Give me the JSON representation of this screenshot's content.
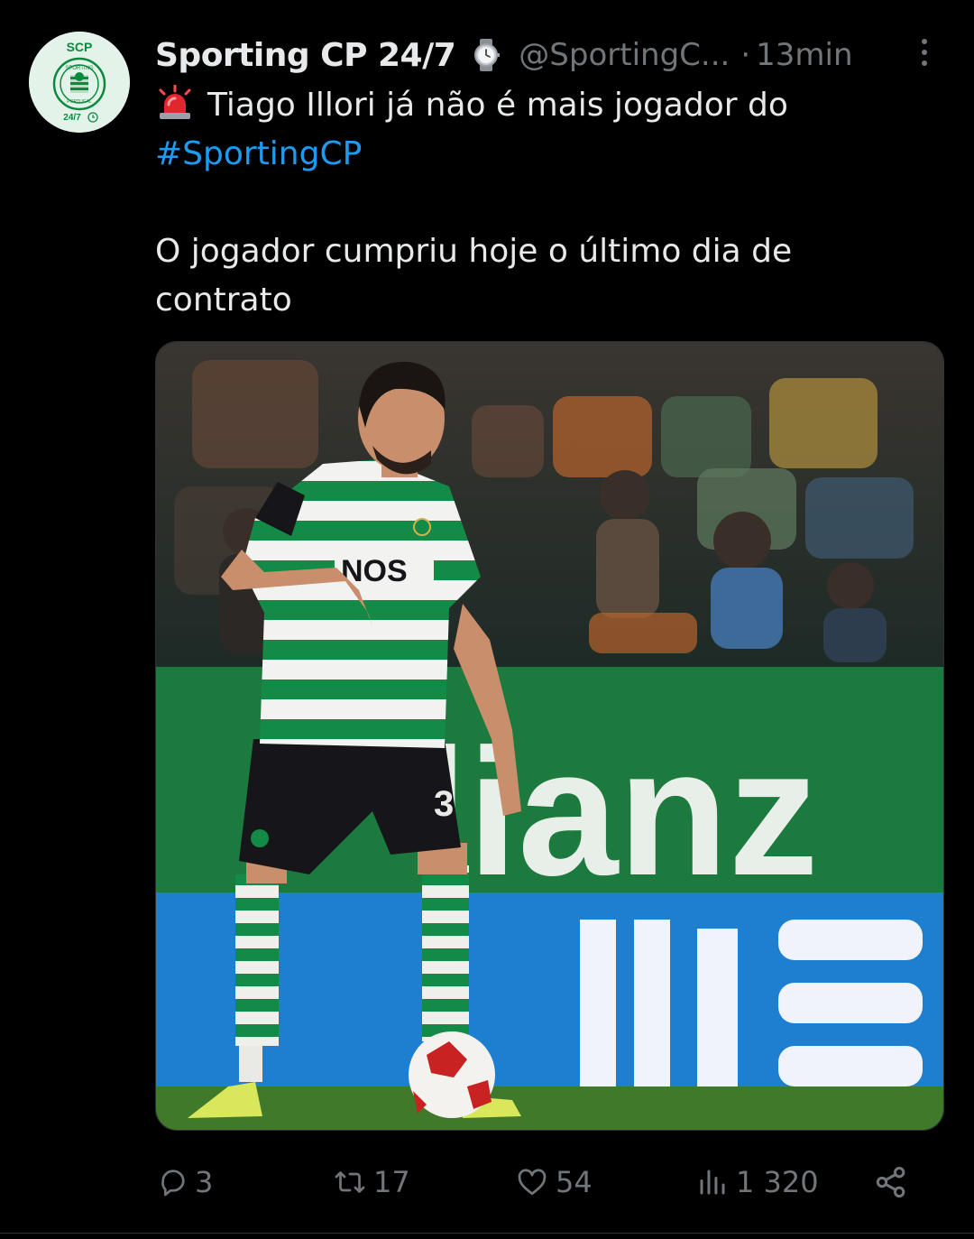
{
  "author": {
    "name": "Sporting CP 24/7",
    "handle": "@SportingC...",
    "separator": "·",
    "time": "13min",
    "avatar": {
      "top_text": "SCP",
      "ring_text": "SPORTING",
      "bottom_text": "PORTUGAL",
      "badge_text": "24/7"
    }
  },
  "tweet": {
    "line1": "Tiago Illori já não é mais jogador do",
    "hashtag": "#SportingCP",
    "line3": "O jogador cumpriu hoje o último dia de",
    "line4": "contrato"
  },
  "media": {
    "sponsor_text": "NOS",
    "board_text": "lianz",
    "shorts_number": "3"
  },
  "actions": {
    "replies": "3",
    "reposts": "17",
    "likes": "54",
    "views": "1 320"
  },
  "icons": {
    "verified": "watch-icon",
    "siren": "police-light-icon",
    "more": "more-icon",
    "reply": "reply-icon",
    "repost": "repost-icon",
    "like": "heart-icon",
    "views": "views-icon",
    "share": "share-icon"
  },
  "colors": {
    "background": "#000000",
    "text": "#e7e9ea",
    "muted": "#71767b",
    "link": "#1d9bf0",
    "sporting_green": "#0b8a3e"
  }
}
